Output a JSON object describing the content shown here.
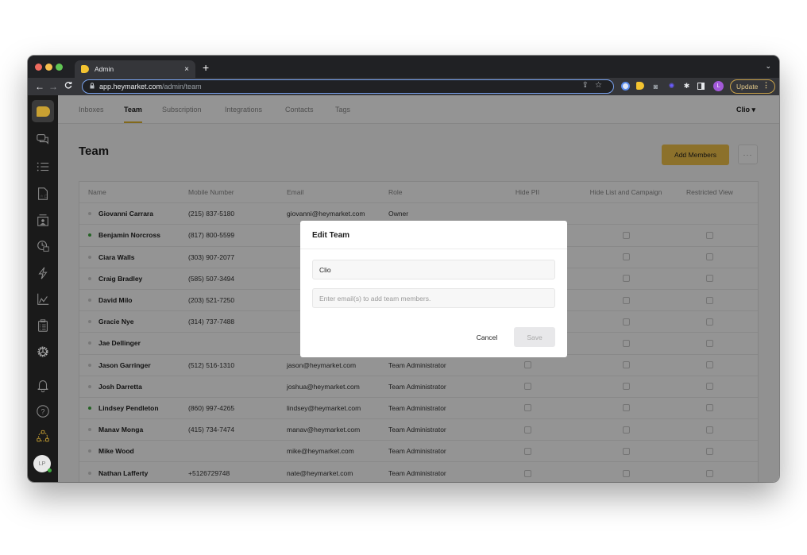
{
  "browser": {
    "tab_title": "Admin",
    "tab_close": "×",
    "new_tab": "+",
    "tab_menu": "⌄",
    "url_host": "app.heymarket.com",
    "url_path": "/admin/team",
    "back": "←",
    "forward": "→",
    "reload": "C",
    "lock": "🔒",
    "omni_icons": "⇪☆",
    "profile_initial": "L",
    "update_label": "Update",
    "update_menu": "⋮",
    "extensions": [
      "grammar-extension-icon",
      "heymarket-extension-icon",
      "camera-extension-icon",
      "sparkle-extension-icon",
      "puzzle-extensions-icon",
      "side-panel-icon"
    ]
  },
  "sidebar": {
    "items": [
      {
        "name": "conversations-icon"
      },
      {
        "name": "lists-icon"
      },
      {
        "name": "templates-icon"
      },
      {
        "name": "contacts-icon"
      },
      {
        "name": "scheduled-icon"
      },
      {
        "name": "automations-icon"
      },
      {
        "name": "reports-icon"
      },
      {
        "name": "surveys-icon"
      },
      {
        "name": "settings-icon"
      },
      {
        "name": "notifications-icon"
      },
      {
        "name": "help-icon"
      },
      {
        "name": "teams-icon"
      }
    ],
    "avatar_initials": "LP",
    "accent": "#c9a132"
  },
  "topnav": {
    "items": [
      "Inboxes",
      "Team",
      "Subscription",
      "Integrations",
      "Contacts",
      "Tags"
    ],
    "active": "Team",
    "team_switch": "Clio ▾"
  },
  "page": {
    "title": "Team",
    "add_members_label": "Add Members",
    "more_label": "···"
  },
  "table": {
    "headers": {
      "name": "Name",
      "mobile": "Mobile Number",
      "email": "Email",
      "role": "Role",
      "hide_pii": "Hide PII",
      "hide_list_campaign": "Hide List and Campaign",
      "restricted_view": "Restricted View"
    },
    "rows": [
      {
        "name": "Giovanni Carrara",
        "mobile": "(215) 837-5180",
        "email": "giovanni@heymarket.com",
        "role": "Owner",
        "online": false,
        "hide_pii": null,
        "hide_list_campaign": null,
        "restricted_view": null
      },
      {
        "name": "Benjamin Norcross",
        "mobile": "(817) 800-5599",
        "email": "",
        "role": "",
        "online": true,
        "hide_pii": false,
        "hide_list_campaign": false,
        "restricted_view": false
      },
      {
        "name": "Ciara Walls",
        "mobile": "(303) 907-2077",
        "email": "",
        "role": "",
        "online": false,
        "hide_pii": false,
        "hide_list_campaign": false,
        "restricted_view": false
      },
      {
        "name": "Craig Bradley",
        "mobile": "(585) 507-3494",
        "email": "",
        "role": "",
        "online": false,
        "hide_pii": false,
        "hide_list_campaign": false,
        "restricted_view": false
      },
      {
        "name": "David Milo",
        "mobile": "(203) 521-7250",
        "email": "",
        "role": "",
        "online": false,
        "hide_pii": false,
        "hide_list_campaign": false,
        "restricted_view": false
      },
      {
        "name": "Gracie Nye",
        "mobile": "(314) 737-7488",
        "email": "",
        "role": "",
        "online": false,
        "hide_pii": false,
        "hide_list_campaign": false,
        "restricted_view": false
      },
      {
        "name": "Jae Dellinger",
        "mobile": "",
        "email": "",
        "role": "",
        "online": false,
        "hide_pii": false,
        "hide_list_campaign": false,
        "restricted_view": false
      },
      {
        "name": "Jason Garringer",
        "mobile": "(512) 516-1310",
        "email": "jason@heymarket.com",
        "role": "Team Administrator",
        "online": false,
        "hide_pii": false,
        "hide_list_campaign": false,
        "restricted_view": false
      },
      {
        "name": "Josh Darretta",
        "mobile": "",
        "email": "joshua@heymarket.com",
        "role": "Team Administrator",
        "online": false,
        "hide_pii": false,
        "hide_list_campaign": false,
        "restricted_view": false
      },
      {
        "name": "Lindsey Pendleton",
        "mobile": "(860) 997-4265",
        "email": "lindsey@heymarket.com",
        "role": "Team Administrator",
        "online": true,
        "hide_pii": false,
        "hide_list_campaign": false,
        "restricted_view": false
      },
      {
        "name": "Manav Monga",
        "mobile": "(415) 734-7474",
        "email": "manav@heymarket.com",
        "role": "Team Administrator",
        "online": false,
        "hide_pii": false,
        "hide_list_campaign": false,
        "restricted_view": false
      },
      {
        "name": "Mike Wood",
        "mobile": "",
        "email": "mike@heymarket.com",
        "role": "Team Administrator",
        "online": false,
        "hide_pii": false,
        "hide_list_campaign": false,
        "restricted_view": false
      },
      {
        "name": "Nathan Lafferty",
        "mobile": "+5126729748",
        "email": "nate@heymarket.com",
        "role": "Team Administrator",
        "online": false,
        "hide_pii": false,
        "hide_list_campaign": false,
        "restricted_view": false
      }
    ]
  },
  "modal": {
    "title": "Edit Team",
    "team_name_value": "Clio",
    "emails_value": "",
    "emails_placeholder": "Enter email(s) to add team members.",
    "cancel_label": "Cancel",
    "save_label": "Save"
  },
  "colors": {
    "brand_yellow": "#f2c34a",
    "online_green": "#3eaa3e",
    "sidebar_bg": "#1a1a1a"
  }
}
